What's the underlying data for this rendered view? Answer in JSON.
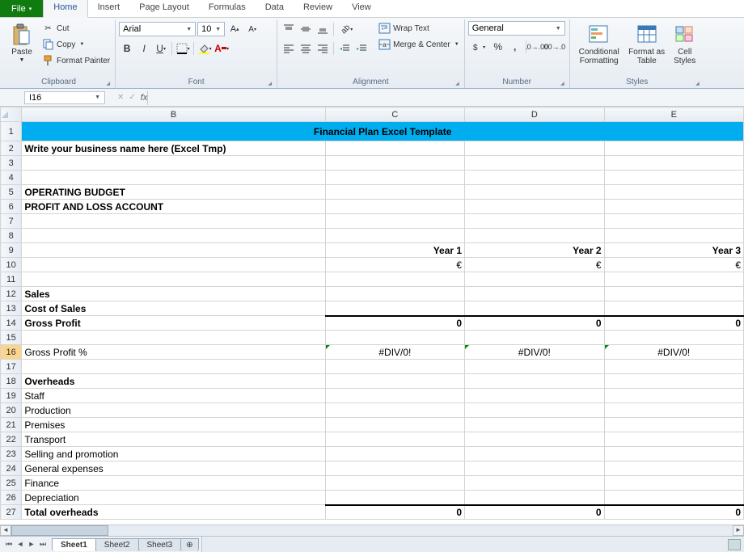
{
  "tabs": [
    "File",
    "Home",
    "Insert",
    "Page Layout",
    "Formulas",
    "Data",
    "Review",
    "View"
  ],
  "active_tab": "Home",
  "clipboard": {
    "paste": "Paste",
    "cut": "Cut",
    "copy": "Copy",
    "brush": "Format Painter",
    "label": "Clipboard"
  },
  "font": {
    "name": "Arial",
    "size": "10",
    "label": "Font"
  },
  "alignment": {
    "wrap": "Wrap Text",
    "merge": "Merge & Center",
    "label": "Alignment"
  },
  "number": {
    "format": "General",
    "label": "Number"
  },
  "styles": {
    "cond": "Conditional Formatting",
    "table": "Format as Table",
    "cell": "Cell Styles",
    "label": "Styles"
  },
  "namebox": "I16",
  "fx": "",
  "cols": [
    "B",
    "C",
    "D",
    "E"
  ],
  "rows": {
    "1": {
      "b": "Financial Plan Excel Template",
      "class": "title-cell",
      "span": "all"
    },
    "2": {
      "b": "Write your business name here (Excel Tmp)",
      "bclass": "bold"
    },
    "3": {},
    "4": {},
    "5": {
      "b": "OPERATING BUDGET",
      "bclass": "bold"
    },
    "6": {
      "b": "PROFIT AND LOSS ACCOUNT",
      "bclass": "bold"
    },
    "7": {},
    "8": {},
    "9": {
      "c": "Year 1",
      "d": "Year 2",
      "e": "Year 3",
      "cclass": "bold right",
      "dclass": "bold right",
      "eclass": "bold right"
    },
    "10": {
      "c": "€",
      "d": "€",
      "e": "€",
      "cclass": "right",
      "dclass": "right",
      "eclass": "right"
    },
    "11": {},
    "12": {
      "b": "Sales",
      "bclass": "bold"
    },
    "13": {
      "b": "Cost of Sales",
      "bclass": "bold"
    },
    "14": {
      "b": "Gross Profit",
      "bclass": "bold",
      "c": "0",
      "d": "0",
      "e": "0",
      "cclass": "bold right underline-t",
      "dclass": "bold right underline-t",
      "eclass": "bold right underline-t"
    },
    "15": {},
    "16": {
      "b": "Gross Profit %",
      "c": "#DIV/0!",
      "d": "#DIV/0!",
      "e": "#DIV/0!",
      "cclass": "center err-tri",
      "dclass": "center err-tri",
      "eclass": "center err-tri",
      "selected": true
    },
    "17": {},
    "18": {
      "b": "Overheads",
      "bclass": "bold"
    },
    "19": {
      "b": "Staff"
    },
    "20": {
      "b": "Production"
    },
    "21": {
      "b": "Premises"
    },
    "22": {
      "b": "Transport"
    },
    "23": {
      "b": "Selling and promotion"
    },
    "24": {
      "b": "General expenses"
    },
    "25": {
      "b": "Finance"
    },
    "26": {
      "b": "Depreciation"
    },
    "27": {
      "b": "Total overheads",
      "bclass": "bold",
      "c": "0",
      "d": "0",
      "e": "0",
      "cclass": "bold right underline-t",
      "dclass": "bold right underline-t",
      "eclass": "bold right underline-t"
    }
  },
  "sheets": [
    "Sheet1",
    "Sheet2",
    "Sheet3"
  ],
  "active_sheet": "Sheet1"
}
